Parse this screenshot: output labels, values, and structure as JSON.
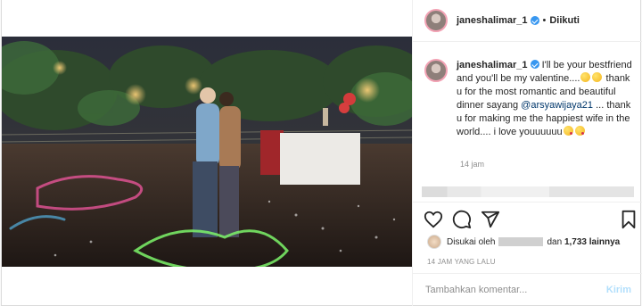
{
  "header": {
    "username": "janeshalimar_1",
    "separator": "•",
    "follow_status": "Diikuti"
  },
  "caption": {
    "username": "janeshalimar_1",
    "text_part1": "I'll be your bestfriend and you'll be my valentine....",
    "text_part2": " thank u for the most romantic and beautiful dinner sayang ",
    "mention": "@arsyawijaya21",
    "text_part3": " ... thank u for making me the happiest wife in the world.... i love youuuuuu",
    "time": "14 jam"
  },
  "likes": {
    "prefix": "Disukai oleh",
    "middle": "dan",
    "count": "1,733 lainnya"
  },
  "timestamp": "14 JAM YANG LALU",
  "add_comment": {
    "placeholder": "Tambahkan komentar...",
    "post_label": "Kirim"
  },
  "icons": [
    "verified-badge-icon",
    "heart-icon",
    "comment-icon",
    "share-icon",
    "bookmark-icon"
  ],
  "colors": {
    "accent": "#3897f0",
    "muted": "#8e8e8e",
    "post_disabled": "#b2dffc",
    "mention": "#00376b"
  }
}
